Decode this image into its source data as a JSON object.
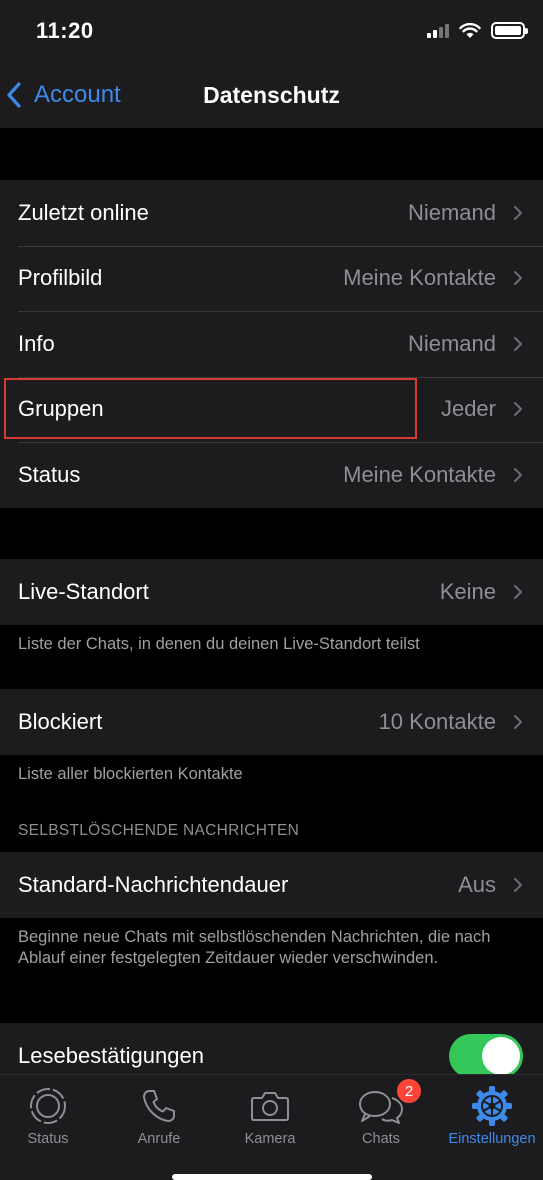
{
  "status_bar": {
    "time": "11:20"
  },
  "nav": {
    "back_label": "Account",
    "title": "Datenschutz"
  },
  "privacy_rows": [
    {
      "label": "Zuletzt online",
      "value": "Niemand"
    },
    {
      "label": "Profilbild",
      "value": "Meine Kontakte"
    },
    {
      "label": "Info",
      "value": "Niemand"
    },
    {
      "label": "Gruppen",
      "value": "Jeder"
    },
    {
      "label": "Status",
      "value": "Meine Kontakte"
    }
  ],
  "live_location": {
    "label": "Live-Standort",
    "value": "Keine",
    "footer": "Liste der Chats, in denen du deinen Live-Standort teilst"
  },
  "blocked": {
    "label": "Blockiert",
    "value": "10 Kontakte",
    "footer": "Liste aller blockierten Kontakte"
  },
  "disappearing": {
    "header": "SELBSTLÖSCHENDE NACHRICHTEN",
    "label": "Standard-Nachrichtendauer",
    "value": "Aus",
    "footer": "Beginne neue Chats mit selbstlöschenden Nachrichten, die nach Ablauf einer festgelegten Zeitdauer wieder verschwinden."
  },
  "read_receipts": {
    "label": "Lesebestätigungen",
    "enabled": true
  },
  "tabs": [
    {
      "label": "Status",
      "icon": "status-icon"
    },
    {
      "label": "Anrufe",
      "icon": "phone-icon"
    },
    {
      "label": "Kamera",
      "icon": "camera-icon"
    },
    {
      "label": "Chats",
      "icon": "chats-icon",
      "badge": "2"
    },
    {
      "label": "Einstellungen",
      "icon": "settings-gear-icon",
      "active": true
    }
  ],
  "colors": {
    "accent": "#3d8aeb",
    "toggle_on": "#34c759",
    "badge": "#ff453a",
    "highlight_box": "#d63a35"
  }
}
